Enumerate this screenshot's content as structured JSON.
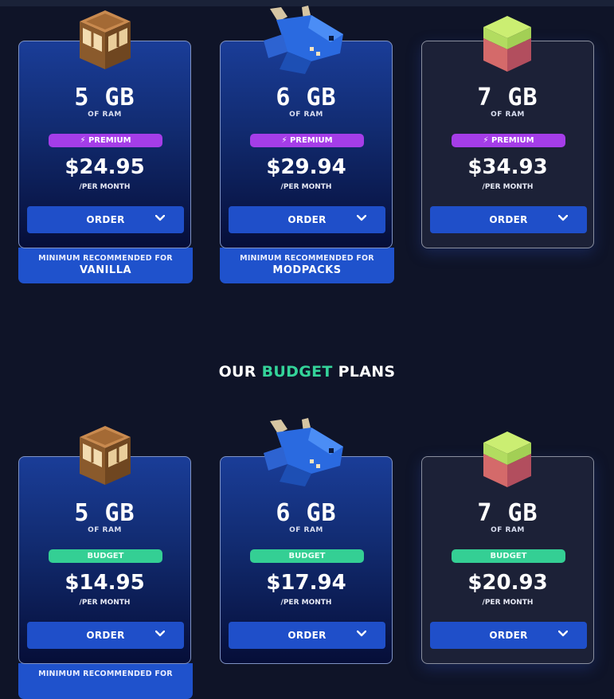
{
  "section": {
    "title_prefix": "OUR ",
    "title_highlight": "BUDGET",
    "title_suffix": " PLANS"
  },
  "premium_plans": [
    {
      "size": "5 GB",
      "ram_label": "OF RAM",
      "badge": "⚡ PREMIUM",
      "price": "$24.95",
      "period": "/PER MONTH",
      "order": "ORDER",
      "rec_line1": "MINIMUM RECOMMENDED FOR",
      "rec_line2": "VANILLA"
    },
    {
      "size": "6 GB",
      "ram_label": "OF RAM",
      "badge": "⚡ PREMIUM",
      "price": "$29.94",
      "period": "/PER MONTH",
      "order": "ORDER",
      "rec_line1": "MINIMUM RECOMMENDED FOR",
      "rec_line2": "MODPACKS"
    },
    {
      "size": "7 GB",
      "ram_label": "OF RAM",
      "badge": "⚡ PREMIUM",
      "price": "$34.93",
      "period": "/PER MONTH",
      "order": "ORDER"
    }
  ],
  "budget_plans": [
    {
      "size": "5 GB",
      "ram_label": "OF RAM",
      "badge": "BUDGET",
      "price": "$14.95",
      "period": "/PER MONTH",
      "order": "ORDER",
      "rec_line1": "MINIMUM RECOMMENDED FOR"
    },
    {
      "size": "6 GB",
      "ram_label": "OF RAM",
      "badge": "BUDGET",
      "price": "$17.94",
      "period": "/PER MONTH",
      "order": "ORDER"
    },
    {
      "size": "7 GB",
      "ram_label": "OF RAM",
      "badge": "BUDGET",
      "price": "$20.93",
      "period": "/PER MONTH",
      "order": "ORDER"
    }
  ],
  "icons": {
    "card1": "crafting-table-icon",
    "card2": "blue-dragon-icon",
    "card3": "grass-block-icon"
  },
  "colors": {
    "premium": "#a53de8",
    "budget": "#34cf94",
    "button": "#1f4fc9",
    "highlight": "#34d399"
  }
}
